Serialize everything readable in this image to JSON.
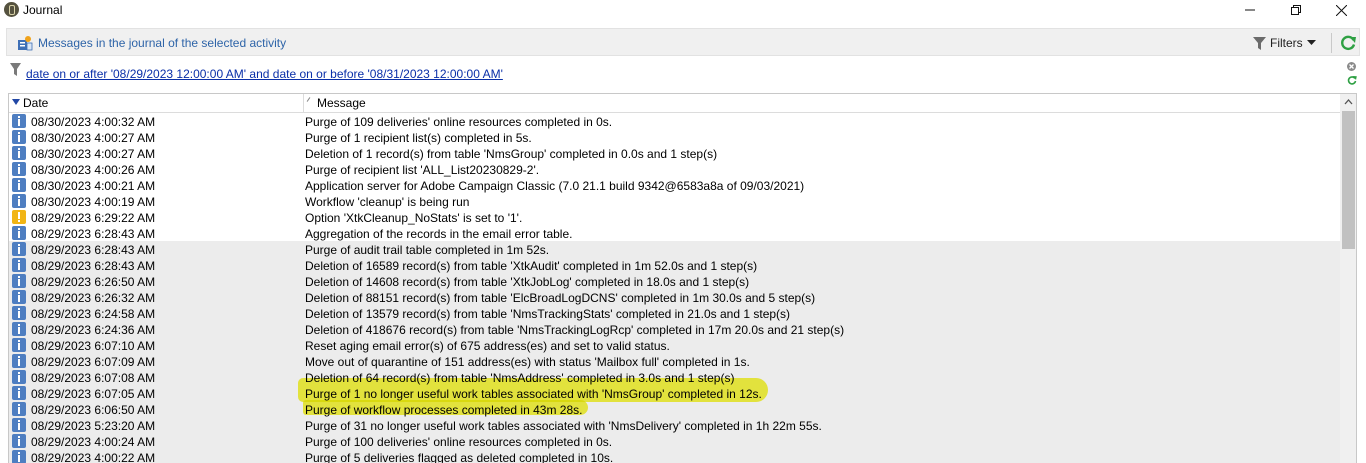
{
  "window": {
    "title": "Journal",
    "controls": [
      "minimize-icon",
      "restore-icon",
      "close-icon"
    ]
  },
  "toolbar": {
    "title": "Messages in the journal of the selected activity",
    "filters_label": "Filters",
    "icons": [
      "journal-icon",
      "funnel-icon",
      "chevron-down-icon",
      "refresh-icon"
    ]
  },
  "filter": {
    "text": "date on or after '08/29/2023 12:00:00 AM' and date on or before '08/31/2023 12:00:00 AM'"
  },
  "grid": {
    "columns": {
      "date": "Date",
      "message": "Message"
    },
    "sort": {
      "column": "Date",
      "direction": "descending"
    },
    "rows": [
      {
        "type": "info",
        "date": "08/30/2023 4:00:32 AM",
        "message": "Purge of 109 deliveries' online resources completed in 0s."
      },
      {
        "type": "info",
        "date": "08/30/2023 4:00:27 AM",
        "message": "Purge of 1 recipient list(s) completed in 5s."
      },
      {
        "type": "info",
        "date": "08/30/2023 4:00:27 AM",
        "message": "Deletion of 1 record(s) from table 'NmsGroup' completed in 0.0s and 1 step(s)"
      },
      {
        "type": "info",
        "date": "08/30/2023 4:00:26 AM",
        "message": "Purge of recipient list 'ALL_List20230829-2'."
      },
      {
        "type": "info",
        "date": "08/30/2023 4:00:21 AM",
        "message": "Application server for Adobe Campaign Classic (7.0 21.1 build 9342@6583a8a of 09/03/2021)"
      },
      {
        "type": "info",
        "date": "08/30/2023 4:00:19 AM",
        "message": "Workflow 'cleanup' is being run"
      },
      {
        "type": "warning",
        "date": "08/29/2023 6:29:22 AM",
        "message": "Option 'XtkCleanup_NoStats' is set to '1'."
      },
      {
        "type": "info",
        "date": "08/29/2023 6:28:43 AM",
        "message": "Aggregation of the records in the email error table."
      },
      {
        "type": "info",
        "date": "08/29/2023 6:28:43 AM",
        "message": "Purge of audit trail table completed in 1m  52s."
      },
      {
        "type": "info",
        "date": "08/29/2023 6:28:43 AM",
        "message": "Deletion of 16589 record(s) from table 'XtkAudit' completed in 1m  52.0s and 1 step(s)"
      },
      {
        "type": "info",
        "date": "08/29/2023 6:26:50 AM",
        "message": "Deletion of 14608 record(s) from table 'XtkJobLog' completed in 18.0s and 1 step(s)"
      },
      {
        "type": "info",
        "date": "08/29/2023 6:26:32 AM",
        "message": "Deletion of 88151 record(s) from table 'ElcBroadLogDCNS' completed in 1m  30.0s and 5 step(s)"
      },
      {
        "type": "info",
        "date": "08/29/2023 6:24:58 AM",
        "message": "Deletion of 13579 record(s) from table 'NmsTrackingStats' completed in 21.0s and 1 step(s)"
      },
      {
        "type": "info",
        "date": "08/29/2023 6:24:36 AM",
        "message": "Deletion of 418676 record(s) from table 'NmsTrackingLogRcp' completed in 17m  20.0s and 21 step(s)"
      },
      {
        "type": "info",
        "date": "08/29/2023 6:07:10 AM",
        "message": "Reset aging email error(s) of 675 address(es) and set to valid status."
      },
      {
        "type": "info",
        "date": "08/29/2023 6:07:09 AM",
        "message": "Move out of quarantine of 151 address(es) with status 'Mailbox full' completed in 1s."
      },
      {
        "type": "info",
        "date": "08/29/2023 6:07:08 AM",
        "message": "Deletion of 64 record(s) from table 'NmsAddress' completed in 3.0s and 1 step(s)"
      },
      {
        "type": "info",
        "date": "08/29/2023 6:07:05 AM",
        "message": "Purge of 1 no longer useful work tables associated with 'NmsGroup' completed in 12s."
      },
      {
        "type": "info",
        "date": "08/29/2023 6:06:50 AM",
        "message": "Purge of workflow processes completed in 43m  28s."
      },
      {
        "type": "info",
        "date": "08/29/2023 5:23:20 AM",
        "message": "Purge of 31 no longer useful work tables associated with 'NmsDelivery' completed in 1h  22m  55s."
      },
      {
        "type": "info",
        "date": "08/29/2023 4:00:24 AM",
        "message": "Purge of 100 deliveries' online resources completed in 0s."
      },
      {
        "type": "info",
        "date": "08/29/2023 4:00:22 AM",
        "message": "Purge of 5 deliveries flagged as deleted completed in 10s."
      }
    ]
  },
  "annotations": {
    "highlight_color": "#f2f20c"
  }
}
